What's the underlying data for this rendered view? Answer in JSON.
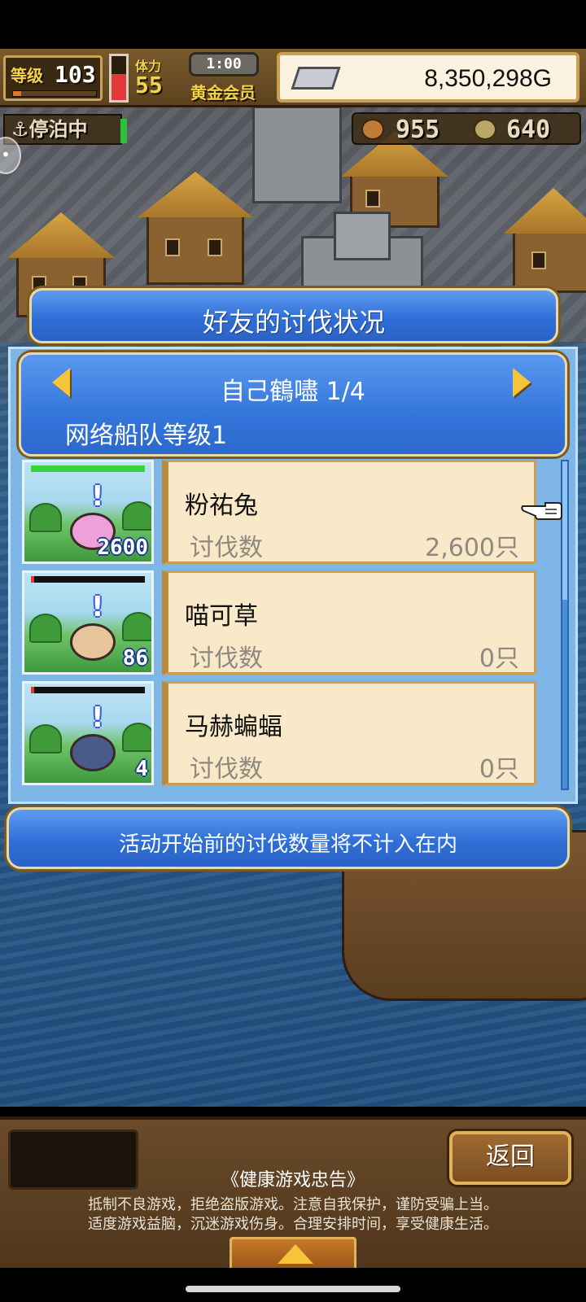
{
  "hud": {
    "level_label": "等级",
    "level_value": "103",
    "level_progress": 0.1,
    "stamina_fill": 0.6,
    "crew_label": "体力",
    "crew_value": "55",
    "timer": "1:00",
    "membership": "黄金会员",
    "money": "8,350,298G",
    "status": "停泊中",
    "food": "955",
    "material": "640"
  },
  "dialog": {
    "title": "好友的讨伐状况",
    "friend_name": "自己鶴嚍 1/4",
    "fleet_level": "网络船队等级1",
    "rows": [
      {
        "name": "粉祐兔",
        "label": "讨伐数",
        "value": "2,600只",
        "badge": "2600",
        "hp": 1.0,
        "monster_color": "#f0a0d8"
      },
      {
        "name": "喵可草",
        "label": "讨伐数",
        "value": "0只",
        "badge": "86",
        "hp": 0.03,
        "monster_color": "#e8c49a"
      },
      {
        "name": "马赫蝙蝠",
        "label": "讨伐数",
        "value": "0只",
        "badge": "4",
        "hp": 0.03,
        "monster_color": "#4a5a8a"
      }
    ],
    "notice": "活动开始前的讨伐数量将不计入在内"
  },
  "bottom": {
    "back_label": "返回",
    "warning_title": "《健康游戏忠告》",
    "warning_line1": "抵制不良游戏，拒绝盗版游戏。注意自我保护，谨防受骗上当。",
    "warning_line2": "适度游戏益脑，沉迷游戏伤身。合理安排时间，享受健康生活。"
  }
}
